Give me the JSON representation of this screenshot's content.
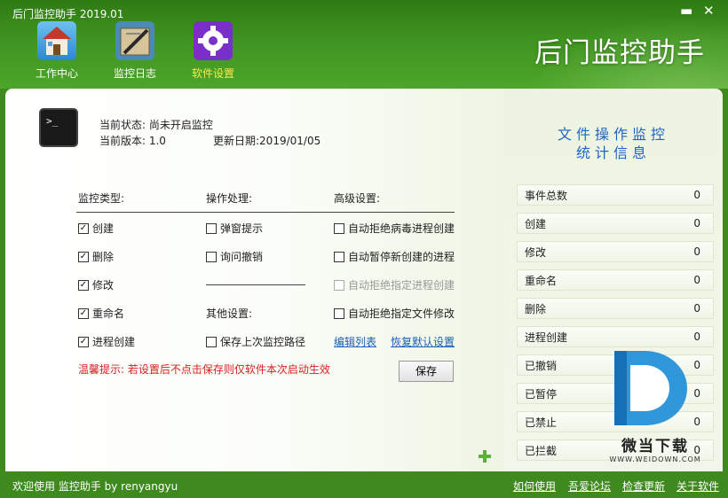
{
  "window": {
    "title": "后门监控助手 2019.01",
    "minimize": "▬",
    "close": "✕"
  },
  "brand": "后门监控助手",
  "nav": [
    {
      "label": "工作中心",
      "icon": "house-icon"
    },
    {
      "label": "监控日志",
      "icon": "log-icon"
    },
    {
      "label": "软件设置",
      "icon": "gear-icon",
      "active": true
    }
  ],
  "status": {
    "state": "当前状态: 尚未开启监控",
    "version": "当前版本: 1.0",
    "updated": "更新日期:2019/01/05"
  },
  "headers": {
    "monitor": "监控类型:",
    "action": "操作处理:",
    "advanced": "高级设置:",
    "other": "其他设置:"
  },
  "monitor_types": [
    {
      "label": "创建",
      "checked": true
    },
    {
      "label": "删除",
      "checked": true
    },
    {
      "label": "修改",
      "checked": true
    },
    {
      "label": "重命名",
      "checked": true
    },
    {
      "label": "进程创建",
      "checked": true
    }
  ],
  "actions": [
    {
      "label": "弹窗提示",
      "checked": false
    },
    {
      "label": "询问撤销",
      "checked": false
    }
  ],
  "other": [
    {
      "label": "保存上次监控路径",
      "checked": false
    }
  ],
  "advanced": [
    {
      "label": "自动拒绝病毒进程创建",
      "checked": false
    },
    {
      "label": "自动暂停新创建的进程",
      "checked": false
    },
    {
      "label": "自动拒绝指定进程创建",
      "checked": false,
      "disabled": true
    },
    {
      "label": "自动拒绝指定文件修改",
      "checked": false
    }
  ],
  "links": {
    "edit_list": "编辑列表",
    "restore_default": "恢复默认设置"
  },
  "warning": "温馨提示: 若设置后不点击保存则仅软件本次启动生效",
  "save_label": "保存",
  "side": {
    "title1": "文件操作监控",
    "title2": "统计信息",
    "stats": [
      {
        "label": "事件总数",
        "value": "0"
      },
      {
        "label": "创建",
        "value": "0"
      },
      {
        "label": "修改",
        "value": "0"
      },
      {
        "label": "重命名",
        "value": "0"
      },
      {
        "label": "删除",
        "value": "0"
      },
      {
        "label": "进程创建",
        "value": "0"
      },
      {
        "label": "已撤销",
        "value": "0"
      },
      {
        "label": "已暂停",
        "value": "0"
      },
      {
        "label": "已禁止",
        "value": "0"
      },
      {
        "label": "已拦截",
        "value": "0"
      }
    ]
  },
  "footer": {
    "welcome": "欢迎使用 监控助手  by  renyangyu",
    "links": [
      "如何使用",
      "吾爱论坛",
      "检查更新",
      "关于软件"
    ]
  },
  "watermark": {
    "text": "微当下载",
    "url": "WWW.WEIDOWN.COM"
  },
  "colors": {
    "accent": "#3f8a1e",
    "link": "#1a5fb4",
    "warning": "#d82020",
    "side_title": "#1e64c8"
  }
}
